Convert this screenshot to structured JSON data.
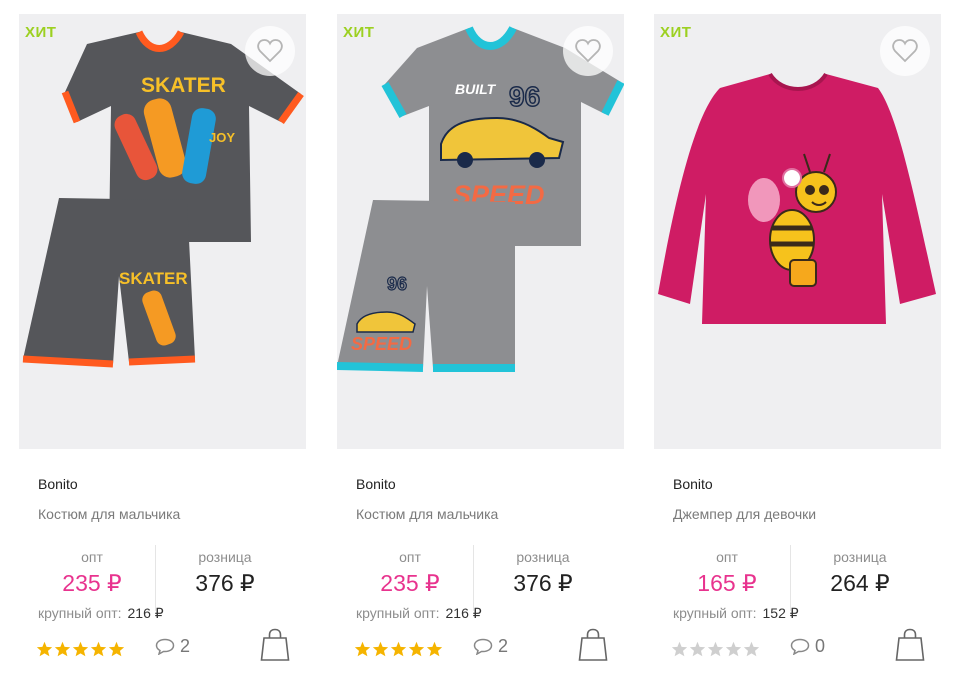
{
  "colors": {
    "hit_badge": "#9cd021",
    "opt_price": "#e8338e",
    "star_active": "#f5b400",
    "star_inactive": "#cfcfcf"
  },
  "labels": {
    "opt": "опт",
    "retail": "розница",
    "bulk": "крупный опт:"
  },
  "products": [
    {
      "badge": "ХИТ",
      "brand": "Bonito",
      "name": "Костюм для мальчика",
      "opt_price": "235 ₽",
      "retail_price": "376 ₽",
      "bulk_price": "216 ₽",
      "rating": 5,
      "comments": "2",
      "image": "grey-tshirt-shorts-skater",
      "print_words": [
        "SKATER",
        "SKATER"
      ]
    },
    {
      "badge": "ХИТ",
      "brand": "Bonito",
      "name": "Костюм для мальчика",
      "opt_price": "235 ₽",
      "retail_price": "376 ₽",
      "bulk_price": "216 ₽",
      "rating": 5,
      "comments": "2",
      "image": "grey-tshirt-shorts-speed",
      "print_words": [
        "BUILT",
        "96",
        "SPEED",
        "96",
        "SPEED"
      ]
    },
    {
      "badge": "ХИТ",
      "brand": "Bonito",
      "name": "Джемпер для девочки",
      "opt_price": "165 ₽",
      "retail_price": "264 ₽",
      "bulk_price": "152 ₽",
      "rating": 0,
      "comments": "0",
      "image": "pink-jumper-bee",
      "print_words": []
    }
  ]
}
